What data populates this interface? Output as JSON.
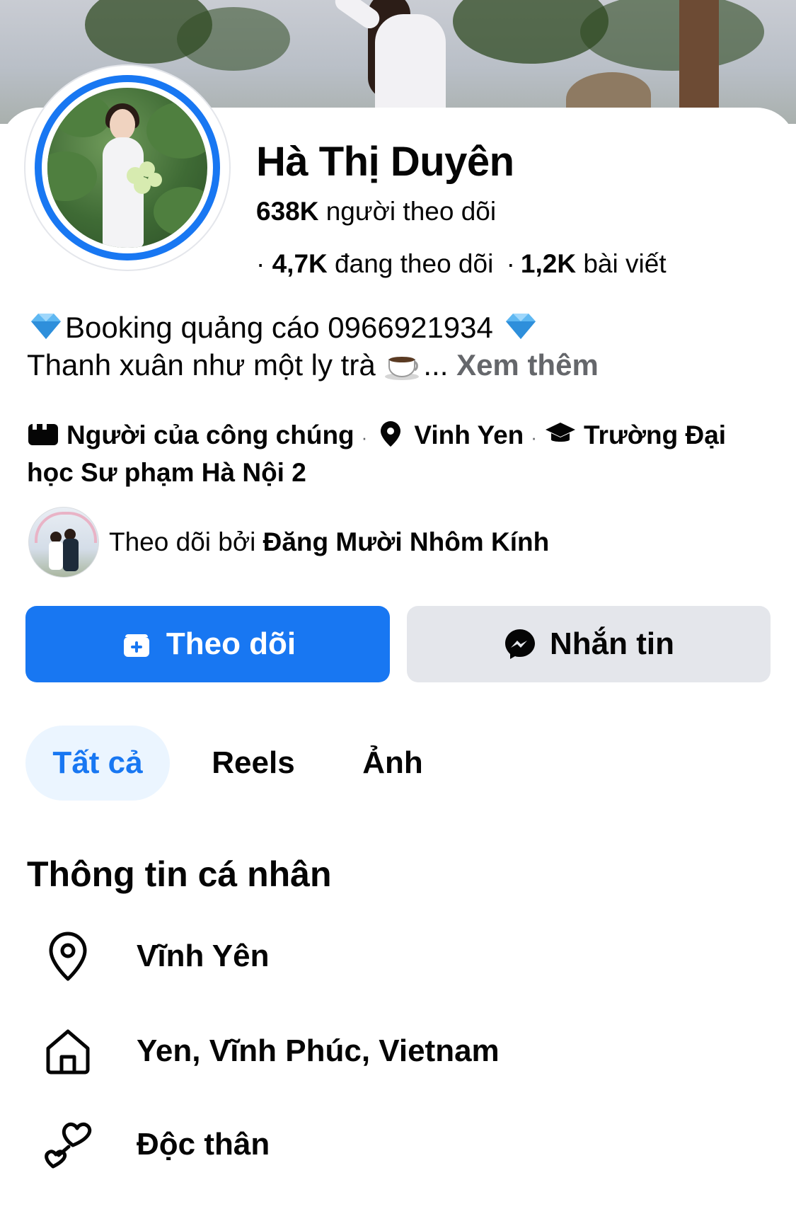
{
  "profile": {
    "name": "Hà Thị Duyên",
    "followers_count": "638K",
    "followers_label": "người theo dõi",
    "following_count": "4,7K",
    "following_label": "đang theo dõi",
    "posts_count": "1,2K",
    "posts_label": "bài viết",
    "bullet": "·"
  },
  "bio": {
    "line1": "Booking quảng cáo 0966921934",
    "line2": "Thanh xuân như một ly trà",
    "ellipsis": "...",
    "see_more": "Xem thêm"
  },
  "details": {
    "category": "Người của công chúng",
    "location": "Vinh Yen",
    "education": "Trường Đại học Sư phạm Hà Nội 2",
    "separator": "·"
  },
  "followed_by": {
    "prefix": "Theo dõi bởi",
    "name": "Đăng Mười Nhôm Kính"
  },
  "actions": {
    "follow_label": "Theo dõi",
    "message_label": "Nhắn tin"
  },
  "tabs": [
    {
      "label": "Tất cả",
      "active": true
    },
    {
      "label": "Reels",
      "active": false
    },
    {
      "label": "Ảnh",
      "active": false
    }
  ],
  "about": {
    "title": "Thông tin cá nhân",
    "items": [
      {
        "icon": "location-pin-icon",
        "text": "Vĩnh Yên"
      },
      {
        "icon": "home-icon",
        "text": "Yen, Vĩnh Phúc, Vietnam"
      },
      {
        "icon": "hearts-icon",
        "text": "Độc thân"
      }
    ]
  },
  "colors": {
    "accent": "#1877f2",
    "secondary_button": "#e4e6eb",
    "active_tab_bg": "#ebf5ff",
    "muted_text": "#65676b"
  }
}
